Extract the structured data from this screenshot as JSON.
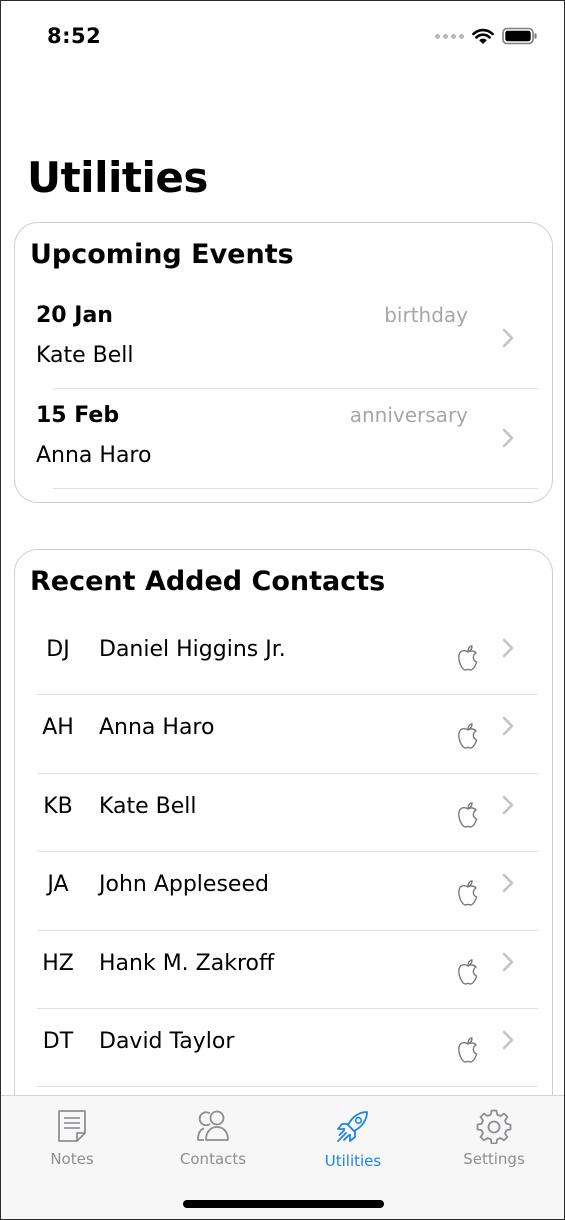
{
  "status_bar": {
    "time": "8:52"
  },
  "page_title": "Utilities",
  "events": {
    "title": "Upcoming Events",
    "items": [
      {
        "date": "20 Jan",
        "name": "Kate Bell",
        "type": "birthday"
      },
      {
        "date": "15 Feb",
        "name": "Anna Haro",
        "type": "anniversary"
      }
    ]
  },
  "contacts": {
    "title": "Recent Added Contacts",
    "items": [
      {
        "initials": "DJ",
        "name": "Daniel Higgins Jr.",
        "source_icon": "apple-icon"
      },
      {
        "initials": "AH",
        "name": "Anna Haro",
        "source_icon": "apple-icon"
      },
      {
        "initials": "KB",
        "name": "Kate Bell",
        "source_icon": "apple-icon"
      },
      {
        "initials": "JA",
        "name": "John Appleseed",
        "source_icon": "apple-icon"
      },
      {
        "initials": "HZ",
        "name": "Hank M. Zakroff",
        "source_icon": "apple-icon"
      },
      {
        "initials": "DT",
        "name": "David Taylor",
        "source_icon": "apple-icon"
      }
    ]
  },
  "tabbar": {
    "active": "Utilities",
    "accent_color": "#1b86e8",
    "inactive_color": "#8e8e93",
    "tabs": [
      {
        "label": "Notes",
        "icon": "notes-icon"
      },
      {
        "label": "Contacts",
        "icon": "contacts-icon"
      },
      {
        "label": "Utilities",
        "icon": "rocket-icon"
      },
      {
        "label": "Settings",
        "icon": "gear-icon"
      }
    ]
  }
}
